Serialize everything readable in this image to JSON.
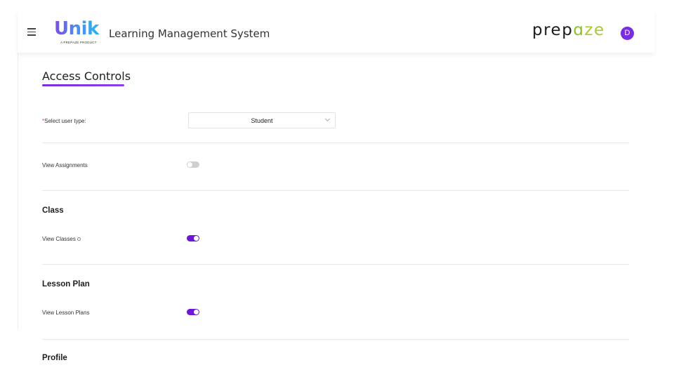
{
  "header": {
    "logo_word": "Unik",
    "logo_tagline": "A PREPAZE PRODUCT",
    "app_title": "Learning Management System",
    "brand_prefix": "prep",
    "brand_o": "ɑ",
    "brand_suffix": "ze",
    "avatar_initial": "D",
    "menu_icon": "hamburger-menu-icon"
  },
  "page": {
    "title": "Access Controls"
  },
  "user_type": {
    "required_mark": "*",
    "label": "Select user type:",
    "selected": "Student"
  },
  "permissions": {
    "view_assignments": {
      "label": "View Assignments",
      "enabled": false
    }
  },
  "sections": [
    {
      "title": "Class",
      "permission": {
        "label": "View Classes",
        "enabled": true,
        "has_info_icon": true
      }
    },
    {
      "title": "Lesson Plan",
      "permission": {
        "label": "View Lesson Plans",
        "enabled": true
      }
    },
    {
      "title": "Profile"
    }
  ],
  "colors": {
    "accent": "#6d16d9",
    "toggle_off": "#cfcfcf",
    "brand_green": "#a6c93a"
  }
}
